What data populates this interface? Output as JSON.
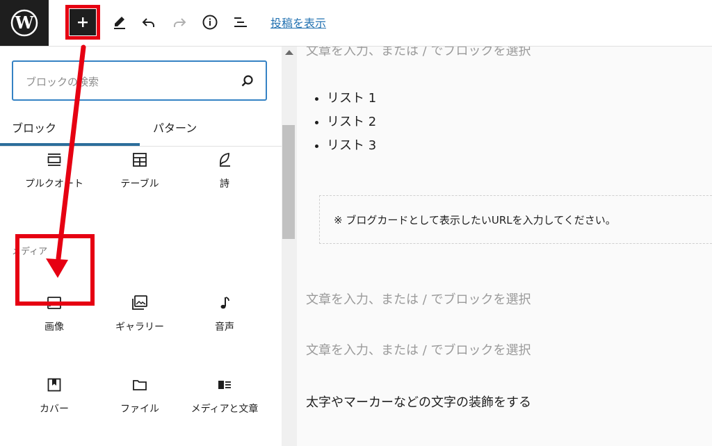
{
  "toolbar": {
    "preview_link": "投稿を表示"
  },
  "inserter": {
    "search_placeholder": "ブロックの検索",
    "tabs": [
      {
        "label": "ブロック",
        "active": true
      },
      {
        "label": "パターン",
        "active": false
      }
    ],
    "row1": [
      {
        "label": "プルクオート",
        "icon": "pullquote-icon"
      },
      {
        "label": "テーブル",
        "icon": "table-icon"
      },
      {
        "label": "詩",
        "icon": "verse-icon"
      }
    ],
    "media_category": "メディア",
    "media_row1": [
      {
        "label": "画像",
        "icon": "image-icon",
        "highlighted": true
      },
      {
        "label": "ギャラリー",
        "icon": "gallery-icon"
      },
      {
        "label": "音声",
        "icon": "audio-icon"
      }
    ],
    "media_row2": [
      {
        "label": "カバー",
        "icon": "cover-icon"
      },
      {
        "label": "ファイル",
        "icon": "file-icon"
      },
      {
        "label": "メディアと文章",
        "icon": "media-text-icon"
      }
    ]
  },
  "editor": {
    "placeholder": "文章を入力、または / でブロックを選択",
    "list_items": [
      "リスト 1",
      "リスト 2",
      "リスト 3"
    ],
    "blogcard_hint": "※ ブログカードとして表示したいURLを入力してください。",
    "paragraph": "太字やマーカーなどの文字の装飾をする"
  },
  "colors": {
    "accent": "#2271b1",
    "annotation_red": "#e60012",
    "dark": "#1e1e1e"
  }
}
